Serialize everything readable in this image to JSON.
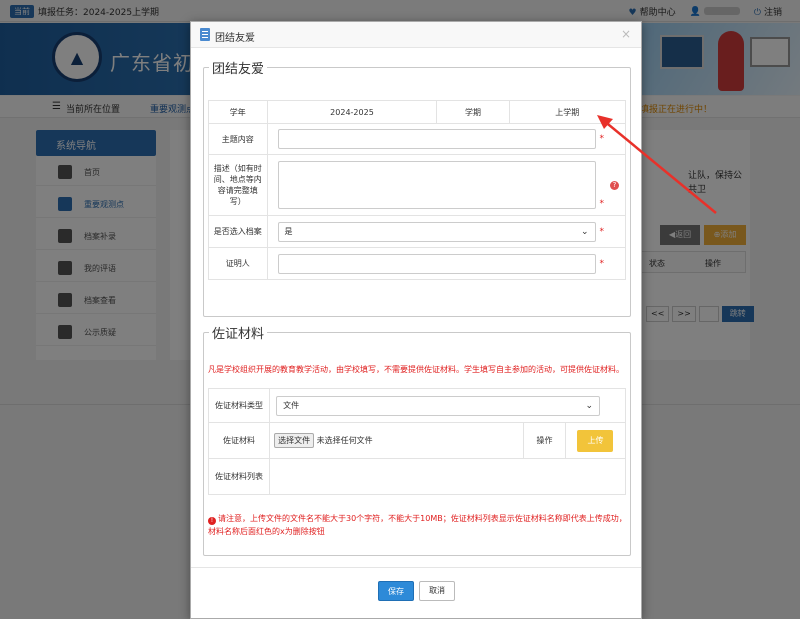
{
  "topbar": {
    "badge": "当前",
    "task": "填报任务：2024-2025上学期",
    "help": "帮助中心",
    "logout": "注销"
  },
  "banner": {
    "site_title": "广东省初中"
  },
  "breadcrumb": {
    "label": "当前所在位置",
    "link": "重要观测点",
    "notice": "填报正在进行中！"
  },
  "sidebar": {
    "title": "系统导航",
    "items": [
      {
        "label": "首页"
      },
      {
        "label": "重要观测点"
      },
      {
        "label": "档案补录"
      },
      {
        "label": "我的评语"
      },
      {
        "label": "档案查看"
      },
      {
        "label": "公示质疑"
      }
    ]
  },
  "background": {
    "right_text": "让队，保持公共卫",
    "back_btn": "返回",
    "add_btn": "添加",
    "col_status": "状态",
    "col_action": "操作",
    "pager_prev": "<<",
    "pager_next": ">>",
    "pager_go": "跳转"
  },
  "modal": {
    "title": "团结友爱",
    "close": "×",
    "section1": {
      "legend": "团结友爱",
      "year_label": "学年",
      "year_value": "2024-2025",
      "term_label": "学期",
      "term_value": "上学期",
      "topic_label": "主题内容",
      "topic_value": "",
      "desc_label": "描述（如有时间、地点等内容请完整填写）",
      "desc_value": "",
      "archive_label": "是否选入档案",
      "archive_value": "是",
      "witness_label": "证明人",
      "witness_value": ""
    },
    "section2": {
      "legend": "佐证材料",
      "note": "凡是学校组织开展的教育教学活动，由学校填写，不需要提供佐证材料。学生填写自主参加的活动，可提供佐证材料。",
      "type_label": "佐证材料类型",
      "type_value": "文件",
      "file_label": "佐证材料",
      "file_button": "选择文件",
      "file_status": "未选择任何文件",
      "action_label": "操作",
      "upload_button": "上传",
      "list_label": "佐证材料列表",
      "warning": "请注意，上传文件的文件名不能大于30个字符，不能大于10MB；佐证材料列表显示佐证材料名称即代表上传成功，材料名称后面红色的x为删除按钮"
    },
    "save_button": "保存",
    "cancel_button": "取消"
  },
  "colors": {
    "accent": "#2d8ad8",
    "required": "#e02020",
    "upload": "#f2c43a",
    "annotation_arrow": "#e8312a"
  }
}
